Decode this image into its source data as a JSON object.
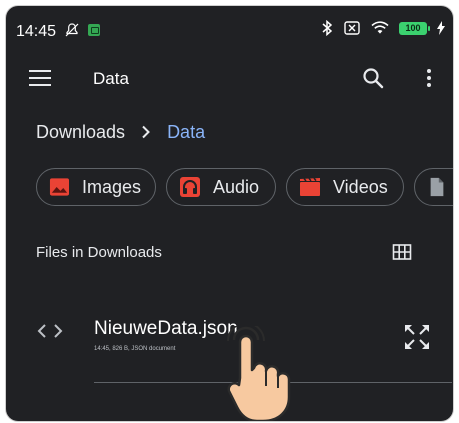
{
  "status_bar": {
    "time": "14:45",
    "battery": "100",
    "icons": [
      "mute-icon",
      "apk-icon",
      "bluetooth-icon",
      "no-sim-icon",
      "wifi-icon",
      "battery-icon",
      "charging-icon"
    ]
  },
  "app_bar": {
    "title": "Data",
    "icons": [
      "menu-icon",
      "search-icon",
      "more-vert-icon"
    ]
  },
  "breadcrumb": {
    "root": "Downloads",
    "current": "Data"
  },
  "chips": [
    {
      "label": "Images",
      "icon": "image-icon",
      "color": "#ea4335"
    },
    {
      "label": "Audio",
      "icon": "headphones-icon",
      "color": "#ea4335"
    },
    {
      "label": "Videos",
      "icon": "movie-icon",
      "color": "#ea4335"
    },
    {
      "label": "",
      "icon": "document-icon",
      "color": "#9aa0a6"
    }
  ],
  "files_section": {
    "title": "Files in Downloads",
    "view_icon": "grid-view-icon"
  },
  "files": [
    {
      "name": "NieuweData.json",
      "meta": "14:45, 826 B, JSON document",
      "icon": "code-icon",
      "action_icon": "fullscreen-icon"
    }
  ],
  "colors": {
    "background": "#202124",
    "accent": "#8ab4f8",
    "chip_icon": "#ea4335"
  }
}
